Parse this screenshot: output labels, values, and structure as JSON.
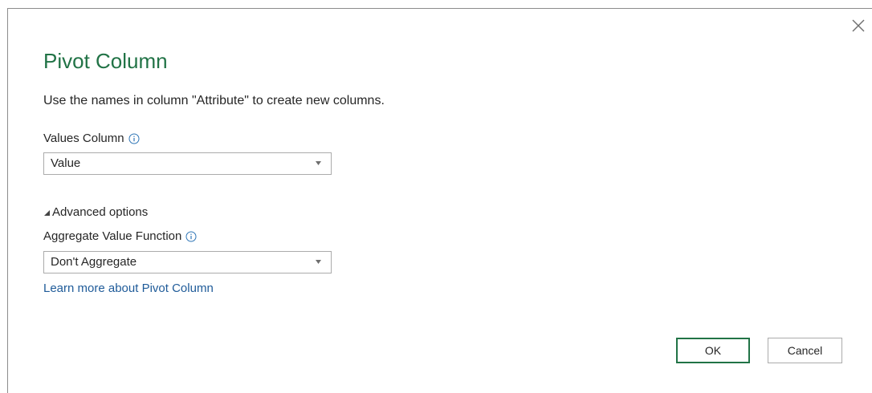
{
  "dialog": {
    "title": "Pivot Column",
    "subtitle": "Use the names in column \"Attribute\" to create new columns.",
    "close_icon": "close-icon"
  },
  "values_column": {
    "label": "Values Column",
    "info_icon": "info-icon",
    "selected": "Value"
  },
  "advanced": {
    "toggle_label": "Advanced options",
    "expanded": true,
    "aggregate_label": "Aggregate Value Function",
    "aggregate_selected": "Don't Aggregate"
  },
  "learn_more": {
    "text": "Learn more about Pivot Column"
  },
  "buttons": {
    "ok": "OK",
    "cancel": "Cancel"
  },
  "colors": {
    "title": "#217346",
    "link": "#1f5b99",
    "ok_border": "#217346",
    "info_icon": "#2e75b6"
  }
}
